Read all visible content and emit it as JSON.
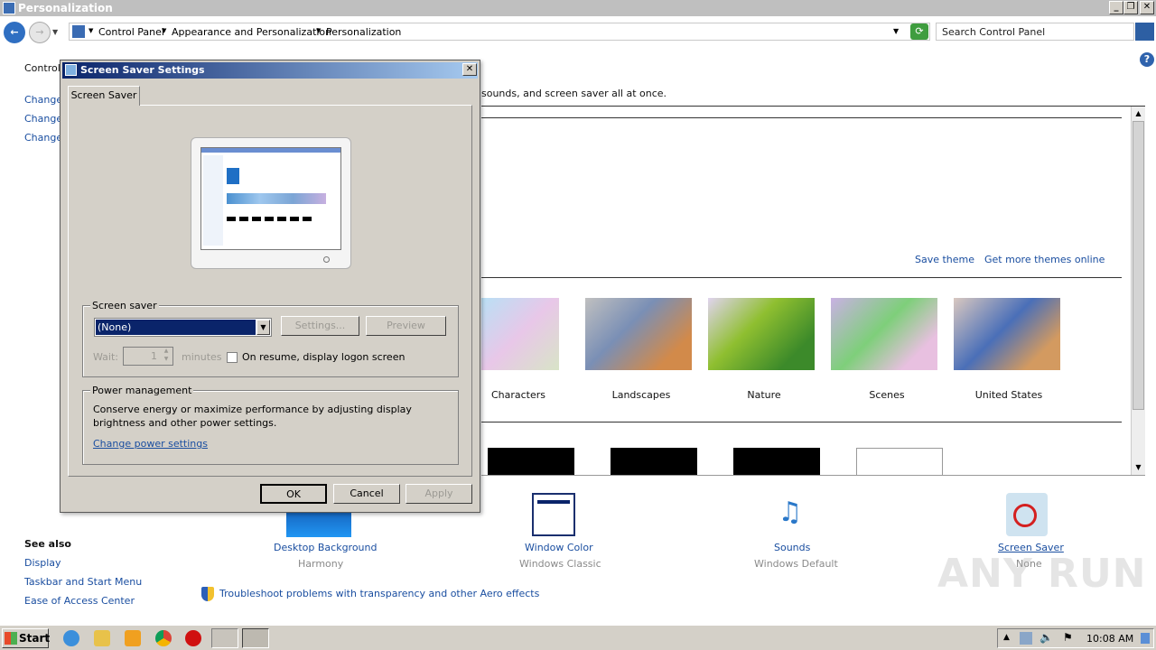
{
  "window": {
    "title": "Personalization"
  },
  "address": {
    "crumbs": [
      "Control Panel",
      "Appearance and Personalization",
      "Personalization"
    ],
    "search_placeholder": "Search Control Panel"
  },
  "sidebar": {
    "top_link": "Control",
    "items": [
      "Change",
      "Change",
      "Change"
    ],
    "see_also_title": "See also",
    "see_also": [
      "Display",
      "Taskbar and Start Menu",
      "Ease of Access Center"
    ]
  },
  "main": {
    "intro_tail": "sounds, and screen saver all at once.",
    "save_theme": "Save theme",
    "get_more_themes": "Get more themes online",
    "themes": [
      "Characters",
      "Landscapes",
      "Nature",
      "Scenes",
      "United States"
    ],
    "bottom_items": [
      {
        "label": "Desktop Background",
        "sub": "Harmony"
      },
      {
        "label": "Window Color",
        "sub": "Windows Classic"
      },
      {
        "label": "Sounds",
        "sub": "Windows Default"
      },
      {
        "label": "Screen Saver",
        "sub": "None"
      }
    ],
    "troubleshoot": "Troubleshoot problems with transparency and other Aero effects"
  },
  "dialog": {
    "title": "Screen Saver Settings",
    "tab": "Screen Saver",
    "screensaver_group": "Screen saver",
    "selected": "(None)",
    "settings_btn": "Settings...",
    "preview_btn": "Preview",
    "wait_label": "Wait:",
    "wait_value": "1",
    "minutes_label": "minutes",
    "resume_label": "On resume, display logon screen",
    "power_group": "Power management",
    "power_text": "Conserve energy or maximize performance by adjusting display brightness and other power settings.",
    "power_link": "Change power settings",
    "ok": "OK",
    "cancel": "Cancel",
    "apply": "Apply"
  },
  "taskbar": {
    "start": "Start",
    "clock": "10:08 AM"
  },
  "watermark": "ANY RUN",
  "colors": {
    "link": "#1a4ea0",
    "dialog_bg": "#d4d0c8",
    "title_grad_start": "#0a246a",
    "title_grad_end": "#a6caf0"
  }
}
